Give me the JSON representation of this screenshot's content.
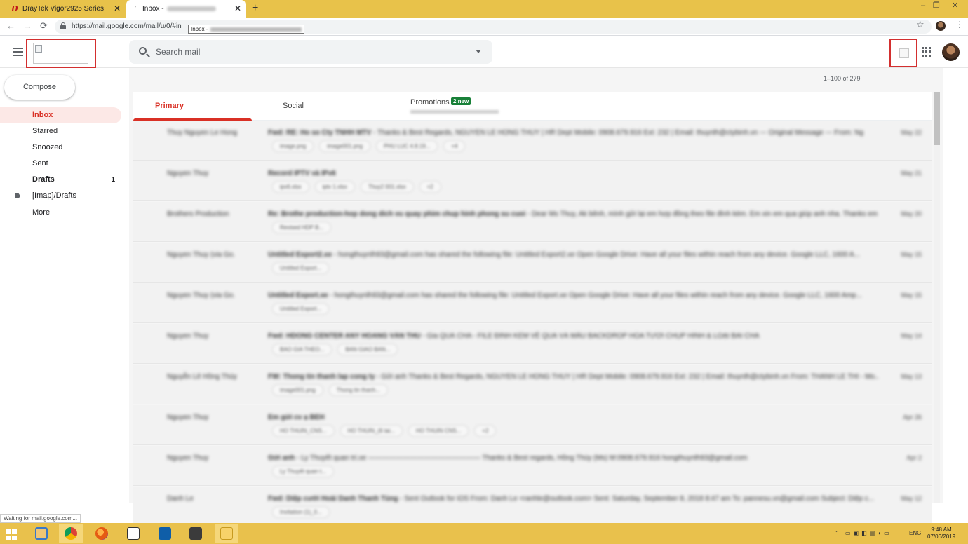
{
  "browser": {
    "tabs": [
      {
        "label": "DrayTek Vigor2925 Series",
        "favicon": "D"
      },
      {
        "label": "Inbox -",
        "favicon": "'"
      }
    ],
    "new_tab": "+",
    "window_controls": {
      "minimize": "–",
      "maximize": "❐",
      "close": "✕"
    },
    "url": "https://mail.google.com/mail/u/0/#in",
    "tooltip": "Inbox -",
    "nav": {
      "back": "←",
      "forward": "→",
      "reload": "⟳"
    },
    "star": "☆",
    "menu": "⋮"
  },
  "gmail": {
    "search_placeholder": "Search mail",
    "compose_label": "Compose",
    "sidebar": [
      {
        "label": "Inbox",
        "count": ""
      },
      {
        "label": "Starred",
        "count": ""
      },
      {
        "label": "Snoozed",
        "count": ""
      },
      {
        "label": "Sent",
        "count": ""
      },
      {
        "label": "Drafts",
        "count": "1"
      },
      {
        "label": "[Imap]/Drafts",
        "count": ""
      },
      {
        "label": "More",
        "count": ""
      }
    ],
    "pager": "1–100 of 279",
    "tabs": {
      "primary": "Primary",
      "social": "Social",
      "promotions": "Promotions",
      "promotions_badge": "2 new"
    },
    "rows": [
      {
        "sender": "Thuy Nguyen Le Hong",
        "subject": "Fwd: RE: Ho so Cty TNHH MTV",
        "snippet": " - Thanks & Best Regards, NGUYEN LE HONG THUY | HR Dept Mobile: 0908.679.916 Ext: 232 | Email: thuynlh@ctybinh.vn --- Original Message --- From: Ng",
        "date": "May 22",
        "chips": [
          "image.png",
          "image001.png",
          "PHU LUC 4.8.19...",
          "+4"
        ]
      },
      {
        "sender": "Nguyen Thuy",
        "subject": "Record IPTV và IPv6",
        "snippet": "",
        "date": "May 21",
        "chips": [
          "ipv6.xlsx",
          "iptv 1.xlsx",
          "Thuy2 001.xlsx",
          "+2"
        ]
      },
      {
        "sender": "Brothers Production",
        "subject": "Re: Brothe production-hop dong dich vu quay phim chup hinh phong su cuoi",
        "snippet": " - Dear Ms Thuy, Ak bênh, mình gửi lại em hợp đồng theo file đính kèm. Em xin em qua giúp anh nha. Thanks em Hào...",
        "date": "May 20",
        "chips": [
          "Revised HDP B..."
        ]
      },
      {
        "sender": "Nguyen Thuy (via Go.",
        "subject": "Untitled Export2.xe",
        "snippet": " - hongthuynlh93@gmail.com has shared the following file: Untitled Export2.xe Open Google Drive: Have all your files within reach from any device. Google LLC, 1600 A...",
        "date": "May 15",
        "chips": [
          "Untitled Export..."
        ]
      },
      {
        "sender": "Nguyen Thuy (via Go.",
        "subject": "Untitled Export.xe",
        "snippet": " - hongthuynlh93@gmail.com has shared the following file: Untitled Export.xe Open Google Drive: Have all your files within reach from any device. Google LLC, 1600 Amp...",
        "date": "May 15",
        "chips": [
          "Untitled Export..."
        ]
      },
      {
        "sender": "Nguyen Thuy",
        "subject": "Fwd: HDONG CENTER ANY HOANG VĂN THU",
        "snippet": " - Gia QUÀ CHA - FILE ĐÍNH KÈM VỀ QUÀ VÀ MẪU BACKDROP HOA TƯƠI CHỤP HÌNH & LOẠI BÀI CHA",
        "date": "May 14",
        "chips": [
          "BAO GIA THEO...",
          "BAN GIAO BAN..."
        ]
      },
      {
        "sender": "Nguyễn Lê Hồng Thúy",
        "subject": "FW: Thong tin thanh lap cong ty",
        "snippet": " - Gửi anh Thanks & Best Regards, NGUYEN LE HONG THUY | HR Dept Mobile: 0908.679.916 Ext: 232 | Email: thuynlh@ctybinh.vn From: THANH LE THI - Mo...",
        "date": "May 13",
        "chips": [
          "image001.png",
          "Thong tin thanh..."
        ]
      },
      {
        "sender": "Nguyen Thuy",
        "subject": "Em gửi cv ạ BEH",
        "snippet": "",
        "date": "Apr 26",
        "chips": [
          "HO THUIN_CNS...",
          "HO THUIN_(6 tai...",
          "HO THUIN CNS...",
          "+2"
        ]
      },
      {
        "sender": "Nguyen Thuy",
        "subject": "Gửi anh",
        "snippet": " - Ly Thuyết quan tri.xe ———————————————— Thanks & Best regards, Hồng Thúy (Ms) M:0908.679.916 hongthuynlh93@gmail.com",
        "date": "Apr 2",
        "chips": [
          "Ly Thuyết quan t..."
        ]
      },
      {
        "sender": "Danh Le",
        "subject": "Fwd: Diệp cưới Hoài Danh Thanh Tùng",
        "snippet": " - Sent Outlook for iOS From: Danh Le <ranhle@outlook.com> Sent: Saturday, September 8, 2018 8:47 am To: pannesu.vn@gmail.com Subject: Diệp c...",
        "date": "May 12",
        "chips": [
          "Invitation (1)_0..."
        ]
      }
    ]
  },
  "statusbar": "Waiting for mail.google.com...",
  "taskbar": {
    "time": "9:48 AM",
    "date": "07/06/2019",
    "lang": "ENG"
  }
}
